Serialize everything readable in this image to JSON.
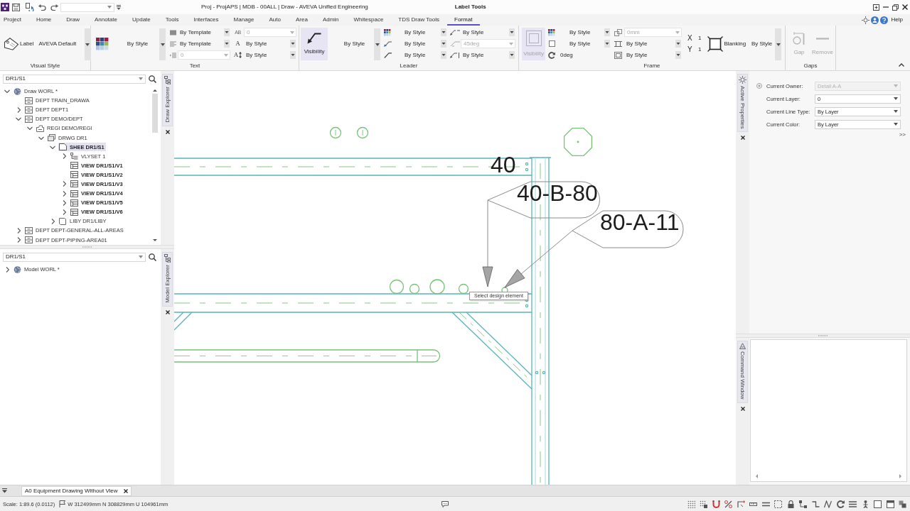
{
  "title_bar": {
    "title": "Proj - ProjAPS | MDB - 00ALL | Draw - AVEVA Unified Engineering",
    "context_label": "Label Tools"
  },
  "ribbon_tabs": [
    {
      "label": "Project",
      "selected": false
    },
    {
      "label": "Home",
      "selected": false
    },
    {
      "label": "Draw",
      "selected": false
    },
    {
      "label": "Annotate",
      "selected": false
    },
    {
      "label": "Update",
      "selected": false
    },
    {
      "label": "Tools",
      "selected": false
    },
    {
      "label": "Interfaces",
      "selected": false
    },
    {
      "label": "Manage",
      "selected": false
    },
    {
      "label": "Auto",
      "selected": false
    },
    {
      "label": "Area",
      "selected": false
    },
    {
      "label": "Admin",
      "selected": false
    },
    {
      "label": "Whitespace",
      "selected": false
    },
    {
      "label": "TDS Draw Tools",
      "selected": false
    },
    {
      "label": "Format",
      "selected": true
    }
  ],
  "help_link": "Help",
  "ribbon": {
    "visual_style": {
      "title": "Visual Style",
      "label_button": "Label",
      "style": "AVEVA Default"
    },
    "text": {
      "title": "Text",
      "color_style": "By Style",
      "fields": [
        {
          "kind": "combo",
          "value": "By Template",
          "disabled": false
        },
        {
          "kind": "combo",
          "value": "By Template",
          "disabled": false
        },
        {
          "kind": "input",
          "value": "0",
          "disabled": true
        },
        {
          "kind": "input",
          "glyph": "AB",
          "value": "0",
          "disabled": true
        },
        {
          "kind": "combo",
          "glyph": "A",
          "value": "By Style",
          "disabled": false
        },
        {
          "kind": "combo",
          "glyph": "A",
          "value": "By Style",
          "disabled": false
        }
      ]
    },
    "leader": {
      "title": "Leader",
      "visibility": {
        "label": "Visibility",
        "disabled": false
      },
      "color_style": "By Style",
      "fields": [
        {
          "kind": "combo",
          "value": "By Style",
          "disabled": false
        },
        {
          "kind": "combo",
          "value": "By Style",
          "disabled": false
        },
        {
          "kind": "combo",
          "value": "By Style",
          "disabled": false
        },
        {
          "kind": "combo",
          "value": "By Style",
          "disabled": false
        },
        {
          "kind": "input",
          "value": "45deg",
          "disabled": true
        },
        {
          "kind": "combo",
          "value": "By Style",
          "disabled": false
        }
      ]
    },
    "frame": {
      "title": "Frame",
      "visibility": {
        "label": "Visibility",
        "disabled": true
      },
      "fields": [
        {
          "kind": "combo",
          "value": "By Style",
          "disabled": false
        },
        {
          "kind": "combo",
          "value": "By Style",
          "disabled": false
        },
        {
          "kind": "value",
          "value": "0deg",
          "disabled": false
        },
        {
          "kind": "input",
          "value": "0mm",
          "disabled": true
        },
        {
          "kind": "combo",
          "value": "By Style",
          "disabled": false
        },
        {
          "kind": "combo",
          "value": "By Style",
          "disabled": false
        }
      ],
      "scale": [
        {
          "axis": "X",
          "value": "1"
        },
        {
          "axis": "Y",
          "value": "1"
        }
      ],
      "blanking": {
        "label": "Blanking",
        "style": "By Style"
      }
    },
    "gaps": {
      "title": "Gaps",
      "buttons": [
        {
          "label": "Gap",
          "disabled": true
        },
        {
          "label": "Remove",
          "disabled": true
        }
      ]
    }
  },
  "draw_explorer": {
    "title": "Draw Explorer",
    "search": "DR1/S1",
    "tree": [
      {
        "label": "Draw WORL *",
        "kind": "world",
        "expanded": true,
        "selected": false,
        "emphasized": false,
        "children": [
          {
            "label": "DEPT TRAIN_DRAWA",
            "kind": "dept",
            "selected": false,
            "emphasized": false
          },
          {
            "label": "DEPT DEPT1",
            "kind": "dept",
            "expanded": false,
            "selected": false,
            "emphasized": false
          },
          {
            "label": "DEPT DEMO/DEPT",
            "kind": "dept",
            "expanded": true,
            "selected": false,
            "emphasized": false,
            "children": [
              {
                "label": "REGI DEMO/REGI",
                "kind": "regi",
                "expanded": true,
                "selected": false,
                "emphasized": false,
                "children": [
                  {
                    "label": "DRWG DR1",
                    "kind": "drwg",
                    "expanded": true,
                    "selected": false,
                    "emphasized": false,
                    "children": [
                      {
                        "label": "SHEE DR1/S1",
                        "kind": "shee",
                        "expanded": true,
                        "selected": true,
                        "emphasized": true,
                        "children": [
                          {
                            "label": "VLYSET 1",
                            "kind": "vlyset",
                            "expanded": false,
                            "selected": false,
                            "emphasized": false
                          },
                          {
                            "label": "VIEW DR1/S1/V1",
                            "kind": "view",
                            "selected": false,
                            "emphasized": true
                          },
                          {
                            "label": "VIEW DR1/S1/V2",
                            "kind": "view",
                            "selected": false,
                            "emphasized": true
                          },
                          {
                            "label": "VIEW DR1/S1/V3",
                            "kind": "view",
                            "expanded": false,
                            "selected": false,
                            "emphasized": true
                          },
                          {
                            "label": "VIEW DR1/S1/V4",
                            "kind": "view",
                            "expanded": false,
                            "selected": false,
                            "emphasized": true
                          },
                          {
                            "label": "VIEW DR1/S1/V5",
                            "kind": "view",
                            "expanded": false,
                            "selected": false,
                            "emphasized": true
                          },
                          {
                            "label": "VIEW DR1/S1/V6",
                            "kind": "view",
                            "expanded": false,
                            "selected": false,
                            "emphasized": true
                          }
                        ]
                      },
                      {
                        "label": "LIBY DR1/LIBY",
                        "kind": "liby",
                        "expanded": false,
                        "selected": false,
                        "emphasized": false
                      }
                    ]
                  }
                ]
              }
            ]
          },
          {
            "label": "DEPT DEPT-GENERAL-ALL-AREAS",
            "kind": "dept",
            "expanded": false,
            "selected": false,
            "emphasized": false
          },
          {
            "label": "DEPT DEPT-PIPING-AREA01",
            "kind": "dept",
            "expanded": false,
            "selected": false,
            "emphasized": false
          }
        ]
      }
    ]
  },
  "model_explorer": {
    "title": "Model Explorer",
    "search": "DR1/S1",
    "tree": [
      {
        "label": "Model WORL *",
        "kind": "world",
        "expanded": false,
        "selected": false,
        "emphasized": false
      }
    ]
  },
  "canvas": {
    "labels": [
      {
        "text": "40",
        "kind": "plain"
      },
      {
        "text": "40-B-80",
        "kind": "balloon"
      },
      {
        "text": "80-A-11",
        "kind": "balloon"
      }
    ],
    "tooltip": "Select design element"
  },
  "active_properties": {
    "title": "Active Properties",
    "rows": [
      {
        "label": "Current Owner:",
        "value": "Detail A-A",
        "disabled": true
      },
      {
        "label": "Current Layer:",
        "value": "0",
        "disabled": false
      },
      {
        "label": "Current Line Type:",
        "value": "By Layer",
        "disabled": false
      },
      {
        "label": "Current Color:",
        "value": "By Layer",
        "disabled": false
      }
    ],
    "more": ">>"
  },
  "command_window": {
    "title": "Command Window"
  },
  "document_tabs": [
    {
      "label": "A0 Equipment Drawing Without View",
      "selected": true
    }
  ],
  "status_bar": {
    "scale": "Scale: 1:89.6 (0.0112)",
    "coordinates": "W 312499mm N 308829mm U 104961mm"
  }
}
